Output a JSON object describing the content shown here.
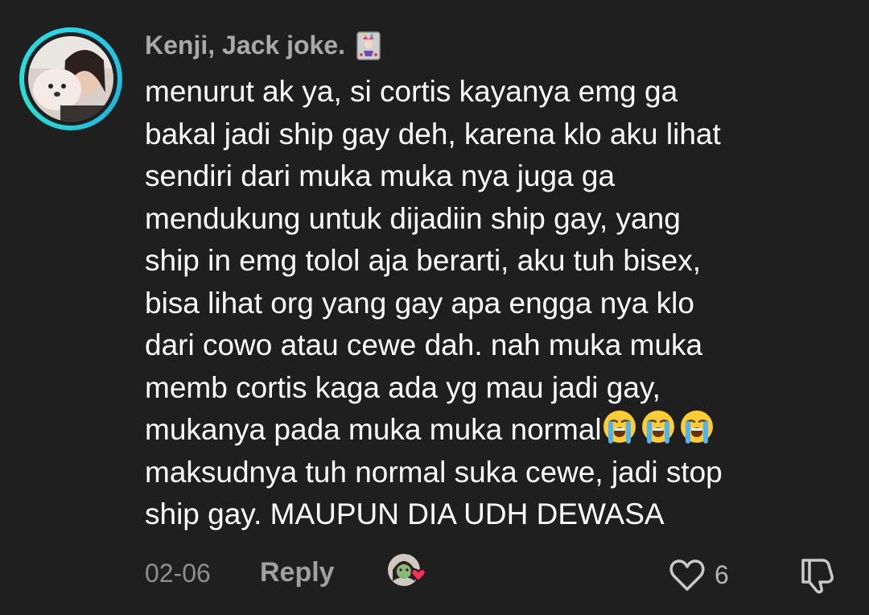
{
  "comment": {
    "username": "Kenji, Jack joke.",
    "badge_icon": "joker-card-icon",
    "text_lines": [
      "menurut ak ya, si cortis kayanya emg ga",
      "bakal jadi ship gay deh, karena klo aku lihat",
      "sendiri dari muka muka nya juga ga",
      "mendukung untuk dijadiin ship gay, yang",
      "ship in emg tolol aja berarti, aku tuh bisex,",
      "bisa lihat org yang gay apa engga nya klo",
      "dari cowo atau cewe dah. nah muka muka",
      "memb cortis kaga ada yg mau jadi gay,",
      "mukanya pada muka muka normal",
      "maksudnya tuh normal suka cewe, jadi stop",
      "ship gay. MAUPUN DIA UDH DEWASA"
    ],
    "emoji_after_line_9": [
      "loudly-crying-face-icon",
      "loudly-crying-face-icon",
      "loudly-crying-face-icon"
    ],
    "date": "02-06",
    "reply_label": "Reply",
    "like_count": "6",
    "colors": {
      "background": "#1f1f1f",
      "avatar_ring": "#27d6e8",
      "heart_badge": "#fe2c55"
    }
  }
}
